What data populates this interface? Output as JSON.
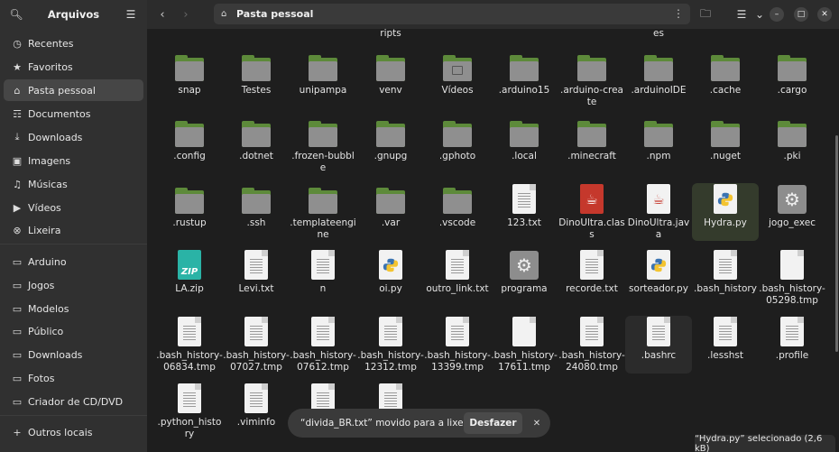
{
  "app": {
    "title": "Arquivos"
  },
  "sidebar": {
    "items": [
      {
        "label": "Recentes",
        "icon": "clock-icon"
      },
      {
        "label": "Favoritos",
        "icon": "star-icon"
      },
      {
        "label": "Pasta pessoal",
        "icon": "home-icon",
        "active": true
      },
      {
        "label": "Documentos",
        "icon": "document-icon"
      },
      {
        "label": "Downloads",
        "icon": "download-icon"
      },
      {
        "label": "Imagens",
        "icon": "image-icon"
      },
      {
        "label": "Músicas",
        "icon": "music-icon"
      },
      {
        "label": "Vídeos",
        "icon": "video-icon"
      },
      {
        "label": "Lixeira",
        "icon": "trash-icon"
      },
      {
        "label": "Arduino",
        "icon": "folder-icon"
      },
      {
        "label": "Jogos",
        "icon": "folder-icon"
      },
      {
        "label": "Modelos",
        "icon": "folder-icon"
      },
      {
        "label": "Público",
        "icon": "folder-icon"
      },
      {
        "label": "Downloads",
        "icon": "folder-icon"
      },
      {
        "label": "Fotos",
        "icon": "folder-icon"
      },
      {
        "label": "Criador de CD/DVD",
        "icon": "folder-icon"
      },
      {
        "label": "Outros locais",
        "icon": "plus-icon"
      }
    ]
  },
  "header": {
    "path": "Pasta pessoal"
  },
  "partial_labels": [
    "ripts",
    "es"
  ],
  "files": [
    {
      "name": "snap",
      "type": "folder"
    },
    {
      "name": "Testes",
      "type": "folder"
    },
    {
      "name": "unipampa",
      "type": "folder"
    },
    {
      "name": "venv",
      "type": "folder"
    },
    {
      "name": "Vídeos",
      "type": "folder-video"
    },
    {
      "name": ".arduino15",
      "type": "folder"
    },
    {
      "name": ".arduino-create",
      "type": "folder"
    },
    {
      "name": ".arduinoIDE",
      "type": "folder"
    },
    {
      "name": ".cache",
      "type": "folder"
    },
    {
      "name": ".cargo",
      "type": "folder"
    },
    {
      "name": ".config",
      "type": "folder"
    },
    {
      "name": ".dotnet",
      "type": "folder"
    },
    {
      "name": ".frozen-bubble",
      "type": "folder"
    },
    {
      "name": ".gnupg",
      "type": "folder"
    },
    {
      "name": ".gphoto",
      "type": "folder"
    },
    {
      "name": ".local",
      "type": "folder"
    },
    {
      "name": ".minecraft",
      "type": "folder"
    },
    {
      "name": ".npm",
      "type": "folder"
    },
    {
      "name": ".nuget",
      "type": "folder"
    },
    {
      "name": ".pki",
      "type": "folder"
    },
    {
      "name": ".rustup",
      "type": "folder"
    },
    {
      "name": ".ssh",
      "type": "folder"
    },
    {
      "name": ".templateengine",
      "type": "folder"
    },
    {
      "name": ".var",
      "type": "folder"
    },
    {
      "name": ".vscode",
      "type": "folder"
    },
    {
      "name": "123.txt",
      "type": "text"
    },
    {
      "name": "DinoUltra.class",
      "type": "java-class"
    },
    {
      "name": "DinoUltra.java",
      "type": "java"
    },
    {
      "name": "Hydra.py",
      "type": "python",
      "selected": true
    },
    {
      "name": "jogo_exec",
      "type": "exec"
    },
    {
      "name": "LA.zip",
      "type": "zip"
    },
    {
      "name": "Levi.txt",
      "type": "text"
    },
    {
      "name": "n",
      "type": "text"
    },
    {
      "name": "oi.py",
      "type": "python"
    },
    {
      "name": "outro_link.txt",
      "type": "text"
    },
    {
      "name": "programa",
      "type": "exec"
    },
    {
      "name": "recorde.txt",
      "type": "text"
    },
    {
      "name": "sorteador.py",
      "type": "python"
    },
    {
      "name": ".bash_history",
      "type": "text"
    },
    {
      "name": ".bash_history-05298.tmp",
      "type": "blank"
    },
    {
      "name": ".bash_history-06834.tmp",
      "type": "text"
    },
    {
      "name": ".bash_history-07027.tmp",
      "type": "text"
    },
    {
      "name": ".bash_history-07612.tmp",
      "type": "text"
    },
    {
      "name": ".bash_history-12312.tmp",
      "type": "text"
    },
    {
      "name": ".bash_history-13399.tmp",
      "type": "text"
    },
    {
      "name": ".bash_history-17611.tmp",
      "type": "blank"
    },
    {
      "name": ".bash_history-24080.tmp",
      "type": "text"
    },
    {
      "name": ".bashrc",
      "type": "text",
      "hover": true
    },
    {
      "name": ".lesshst",
      "type": "text"
    },
    {
      "name": ".profile",
      "type": "text"
    },
    {
      "name": ".python_history",
      "type": "text"
    },
    {
      "name": ".viminfo",
      "type": "text"
    },
    {
      "name": "",
      "type": "text"
    },
    {
      "name": "",
      "type": "text"
    }
  ],
  "toast": {
    "message": "“divida_BR.txt” movido para a lixeira",
    "undo": "Desfazer"
  },
  "status": "“Hydra.py” selecionado  (2,6 kB)"
}
